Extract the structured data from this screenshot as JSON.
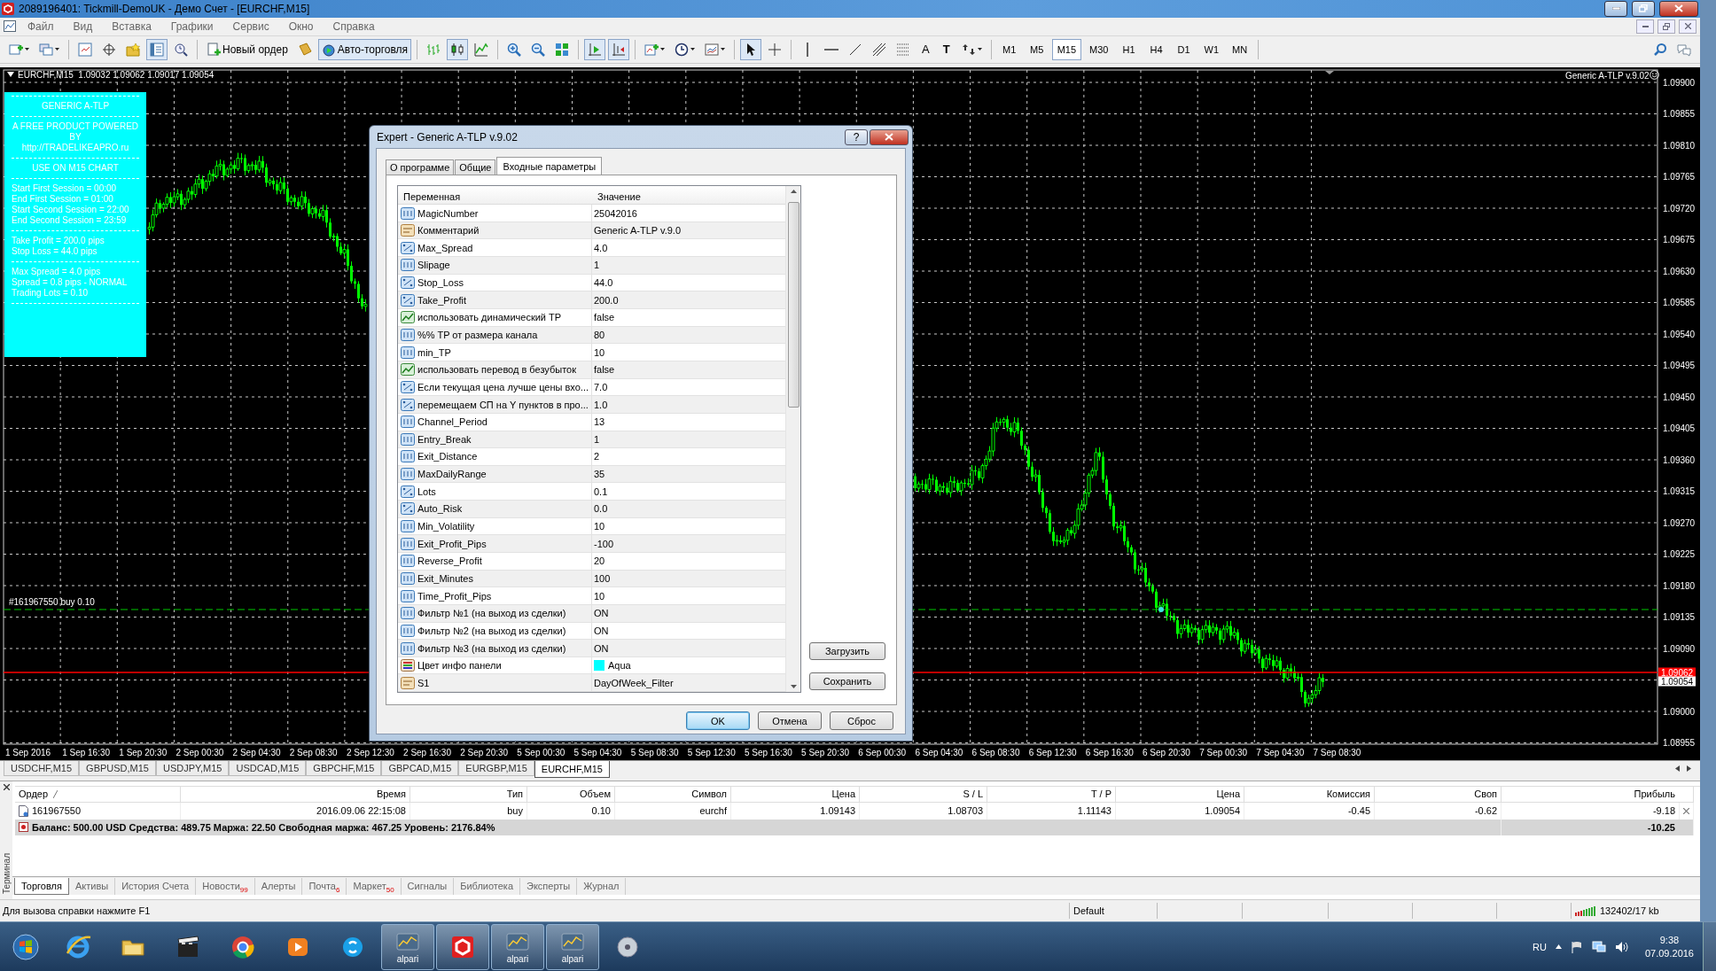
{
  "window": {
    "title": "2089196401: Tickmill-DemoUK - Демо Счет - [EURCHF,M15]"
  },
  "menu": [
    "Файл",
    "Вид",
    "Вставка",
    "Графики",
    "Сервис",
    "Окно",
    "Справка"
  ],
  "toolbar": [
    {
      "kind": "new_chart",
      "pressed": false
    },
    {
      "kind": "profiles",
      "pressed": false
    },
    {
      "kind": "separator"
    },
    {
      "kind": "market_watch",
      "pressed": false
    },
    {
      "kind": "data_window",
      "pressed": false
    },
    {
      "kind": "navigator",
      "pressed": false
    },
    {
      "kind": "terminal",
      "pressed": true
    },
    {
      "kind": "tester",
      "pressed": false
    },
    {
      "kind": "separator"
    },
    {
      "kind": "new_order",
      "label": "Новый ордер",
      "pressed": false
    },
    {
      "kind": "editor",
      "pressed": false
    },
    {
      "kind": "auto_trading",
      "label": "Авто-торговля",
      "pressed": true
    },
    {
      "kind": "separator"
    },
    {
      "kind": "bar_chart",
      "pressed": false
    },
    {
      "kind": "candles",
      "pressed": true
    },
    {
      "kind": "line_chart",
      "pressed": false
    },
    {
      "kind": "separator"
    },
    {
      "kind": "zoom_in",
      "pressed": false
    },
    {
      "kind": "zoom_out",
      "pressed": false
    },
    {
      "kind": "tile",
      "pressed": false
    },
    {
      "kind": "separator"
    },
    {
      "kind": "autoscroll",
      "pressed": true
    },
    {
      "kind": "chart_shift",
      "pressed": true
    },
    {
      "kind": "separator"
    },
    {
      "kind": "indicators",
      "pressed": false
    },
    {
      "kind": "periods",
      "pressed": false
    },
    {
      "kind": "templates",
      "pressed": false
    },
    {
      "kind": "separator"
    },
    {
      "kind": "cursor",
      "pressed": true
    },
    {
      "kind": "crosshair",
      "pressed": false
    },
    {
      "kind": "separator"
    },
    {
      "kind": "vline",
      "pressed": false
    },
    {
      "kind": "hline",
      "pressed": false
    },
    {
      "kind": "trendline",
      "pressed": false
    },
    {
      "kind": "channel",
      "pressed": false
    },
    {
      "kind": "fibo",
      "pressed": false
    },
    {
      "kind": "text_tool",
      "label": "A",
      "pressed": false
    },
    {
      "kind": "text_label",
      "label": "T",
      "pressed": false
    },
    {
      "kind": "arrows",
      "pressed": false
    },
    {
      "kind": "separator"
    }
  ],
  "timeframes": [
    {
      "label": "M1",
      "selected": false
    },
    {
      "label": "M5",
      "selected": false
    },
    {
      "label": "M15",
      "selected": true
    },
    {
      "label": "M30",
      "selected": false
    },
    {
      "label": "H1",
      "selected": false
    },
    {
      "label": "H4",
      "selected": false
    },
    {
      "label": "D1",
      "selected": false
    },
    {
      "label": "W1",
      "selected": false
    },
    {
      "label": "MN",
      "selected": false
    }
  ],
  "toolbar_right": [
    {
      "kind": "search",
      "pressed": false
    },
    {
      "kind": "chat",
      "pressed": false
    }
  ],
  "chart": {
    "header": "EURCHF,M15  1.09032 1.09062 1.09017 1.09054",
    "expert_label": "Generic A-TLP v.9.02",
    "order_label": "#161967550 buy 0.10",
    "price_labels": [
      "1.09900",
      "1.09855",
      "1.09810",
      "1.09765",
      "1.09720",
      "1.09675",
      "1.09630",
      "1.09585",
      "1.09540",
      "1.09495",
      "1.09450",
      "1.09405",
      "1.09360",
      "1.09315",
      "1.09270",
      "1.09225",
      "1.09180",
      "1.09135",
      "1.09090",
      "1.09000",
      "1.08955"
    ],
    "high_marker": "1.09062",
    "bid_marker": "1.09054",
    "time_labels": [
      "1 Sep 2016",
      "1 Sep 16:30",
      "1 Sep 20:30",
      "2 Sep 00:30",
      "2 Sep 04:30",
      "2 Sep 08:30",
      "2 Sep 12:30",
      "2 Sep 16:30",
      "2 Sep 20:30",
      "5 Sep 00:30",
      "5 Sep 04:30",
      "5 Sep 08:30",
      "5 Sep 12:30",
      "5 Sep 16:30",
      "5 Sep 20:30",
      "6 Sep 00:30",
      "6 Sep 04:30",
      "6 Sep 08:30",
      "6 Sep 12:30",
      "6 Sep 16:30",
      "6 Sep 20:30",
      "7 Sep 00:30",
      "7 Sep 04:30",
      "7 Sep 08:30"
    ]
  },
  "info_panel": {
    "heading_sections": [
      {
        "lines": [
          "GENERIC A-TLP"
        ]
      },
      {
        "lines": [
          "A FREE PRODUCT POWERED",
          "BY",
          "http://TRADELIKEAPRO.ru"
        ]
      },
      {
        "lines": [
          "USE ON M15 CHART"
        ]
      }
    ],
    "sections": [
      {
        "lines": [
          "Start First Session = 00:00",
          "End First Session = 01:00",
          "Start Second Session = 22:00",
          "End Second Session = 23:59"
        ]
      },
      {
        "lines": [
          "Take Profit = 200.0 pips",
          "Stop Loss = 44.0 pips"
        ]
      },
      {
        "lines": [
          "Max Spread = 4.0 pips",
          "Spread = 0.8 pips - NORMAL",
          "Trading Lots = 0.10"
        ]
      }
    ]
  },
  "dialog": {
    "title": "Expert - Generic A-TLP v.9.02",
    "help": "?",
    "tabs": [
      {
        "label": "О программе",
        "selected": false
      },
      {
        "label": "Общие",
        "selected": false
      },
      {
        "label": "Входные параметры",
        "selected": true
      }
    ],
    "columns": [
      "Переменная",
      "Значение"
    ],
    "params": [
      {
        "kind": "int",
        "name": "MagicNumber",
        "value": "25042016"
      },
      {
        "kind": "string",
        "name": "Комментарий",
        "value": "Generic A-TLP v.9.0"
      },
      {
        "kind": "double",
        "name": "Max_Spread",
        "value": "4.0"
      },
      {
        "kind": "int",
        "name": "Slipage",
        "value": "1"
      },
      {
        "kind": "double",
        "name": "Stop_Loss",
        "value": "44.0"
      },
      {
        "kind": "double",
        "name": "Take_Profit",
        "value": "200.0"
      },
      {
        "kind": "bool",
        "name": "использовать динамический TP",
        "value": "false"
      },
      {
        "kind": "int",
        "name": "%% TP от размера канала",
        "value": "80"
      },
      {
        "kind": "int",
        "name": "min_TP",
        "value": "10"
      },
      {
        "kind": "bool",
        "name": "использовать перевод в безубыток",
        "value": "false"
      },
      {
        "kind": "double",
        "name": "Если текущая цена лучше цены вхо...",
        "value": "7.0"
      },
      {
        "kind": "double",
        "name": "перемещаем СП на Y пунктов в про...",
        "value": "1.0"
      },
      {
        "kind": "int",
        "name": "Channel_Period",
        "value": "13"
      },
      {
        "kind": "int",
        "name": "Entry_Break",
        "value": "1"
      },
      {
        "kind": "int",
        "name": "Exit_Distance",
        "value": "2"
      },
      {
        "kind": "int",
        "name": "MaxDailyRange",
        "value": "35"
      },
      {
        "kind": "double",
        "name": "Lots",
        "value": "0.1"
      },
      {
        "kind": "double",
        "name": "Auto_Risk",
        "value": "0.0"
      },
      {
        "kind": "int",
        "name": "Min_Volatility",
        "value": "10"
      },
      {
        "kind": "int",
        "name": "Exit_Profit_Pips",
        "value": "-100"
      },
      {
        "kind": "int",
        "name": "Reverse_Profit",
        "value": "20"
      },
      {
        "kind": "int",
        "name": "Exit_Minutes",
        "value": "100"
      },
      {
        "kind": "int",
        "name": "Time_Profit_Pips",
        "value": "10"
      },
      {
        "kind": "int",
        "name": "Фильтр №1 (на выход из сделки)",
        "value": "ON"
      },
      {
        "kind": "int",
        "name": "Фильтр №2 (на выход из сделки)",
        "value": "ON"
      },
      {
        "kind": "int",
        "name": "Фильтр №3 (на выход из сделки)",
        "value": "ON"
      },
      {
        "kind": "color",
        "name": "Цвет инфо панели",
        "value": "Aqua",
        "color": "#00ffff"
      },
      {
        "kind": "string",
        "name": "S1",
        "value": "DayOfWeek_Filter"
      }
    ],
    "side_buttons": [
      "Загрузить",
      "Сохранить"
    ],
    "buttons": [
      {
        "label": "OK",
        "default": true
      },
      {
        "label": "Отмена",
        "default": false
      },
      {
        "label": "Сброс",
        "default": false
      }
    ]
  },
  "chart_tabs": [
    {
      "label": "USDCHF,M15",
      "selected": false
    },
    {
      "label": "GBPUSD,M15",
      "selected": false
    },
    {
      "label": "USDJPY,M15",
      "selected": false
    },
    {
      "label": "USDCAD,M15",
      "selected": false
    },
    {
      "label": "GBPCHF,M15",
      "selected": false
    },
    {
      "label": "GBPCAD,M15",
      "selected": false
    },
    {
      "label": "EURGBP,M15",
      "selected": false
    },
    {
      "label": "EURCHF,M15",
      "selected": true
    }
  ],
  "terminal": {
    "side_label": "Терминал",
    "columns": [
      {
        "label": "Ордер",
        "sorted": true
      },
      {
        "label": "Время",
        "sorted": false
      },
      {
        "label": "Тип",
        "sorted": false
      },
      {
        "label": "Объем",
        "sorted": false
      },
      {
        "label": "Символ",
        "sorted": false
      },
      {
        "label": "Цена",
        "sorted": false
      },
      {
        "label": "S / L",
        "sorted": false
      },
      {
        "label": "T / P",
        "sorted": false
      },
      {
        "label": "Цена",
        "sorted": false
      },
      {
        "label": "Комиссия",
        "sorted": false
      },
      {
        "label": "Своп",
        "sorted": false
      },
      {
        "label": "Прибыль",
        "sorted": false
      }
    ],
    "orders": [
      {
        "cells": [
          "161967550",
          "2016.09.06 22:15:08",
          "buy",
          "0.10",
          "eurchf",
          "1.09143",
          "1.08703",
          "1.11143",
          "1.09054",
          "-0.45",
          "-0.62",
          "-9.18"
        ]
      }
    ],
    "balance": {
      "summary": "Баланс: 500.00 USD  Средства: 489.75  Маржа: 22.50  Свободная маржа: 467.25  Уровень: 2176.84%",
      "profit": "-10.25"
    },
    "tabs": [
      {
        "label": "Торговля",
        "selected": true
      },
      {
        "label": "Активы",
        "selected": false
      },
      {
        "label": "История Счета",
        "selected": false
      },
      {
        "label": "Новости",
        "badge": "99",
        "selected": false
      },
      {
        "label": "Алерты",
        "selected": false
      },
      {
        "label": "Почта",
        "badge": "6",
        "selected": false
      },
      {
        "label": "Маркет",
        "badge": "50",
        "selected": false
      },
      {
        "label": "Сигналы",
        "selected": false
      },
      {
        "label": "Библиотека",
        "selected": false
      },
      {
        "label": "Эксперты",
        "selected": false
      },
      {
        "label": "Журнал",
        "selected": false
      }
    ]
  },
  "status_bar": {
    "help": "Для вызова справки нажмите F1",
    "profile": "Default",
    "traffic": "132402/17 kb"
  },
  "taskbar": {
    "apps": [
      {
        "kind": "start",
        "running": false
      },
      {
        "kind": "browser",
        "running": false
      },
      {
        "kind": "folder",
        "running": false
      },
      {
        "kind": "clapper",
        "running": false
      },
      {
        "kind": "round_browser",
        "running": false
      },
      {
        "kind": "player",
        "running": false
      },
      {
        "kind": "messenger",
        "running": false
      },
      {
        "kind": "chart_app",
        "label": "alpari",
        "running": true
      },
      {
        "kind": "hexagon_app",
        "running": true
      },
      {
        "kind": "chart_app",
        "label": "alpari",
        "running": true
      },
      {
        "kind": "chart_app",
        "label": "alpari",
        "running": true
      },
      {
        "kind": "disc",
        "running": false
      }
    ],
    "language": "RU",
    "time": "9:38",
    "date": "07.09.2016"
  }
}
